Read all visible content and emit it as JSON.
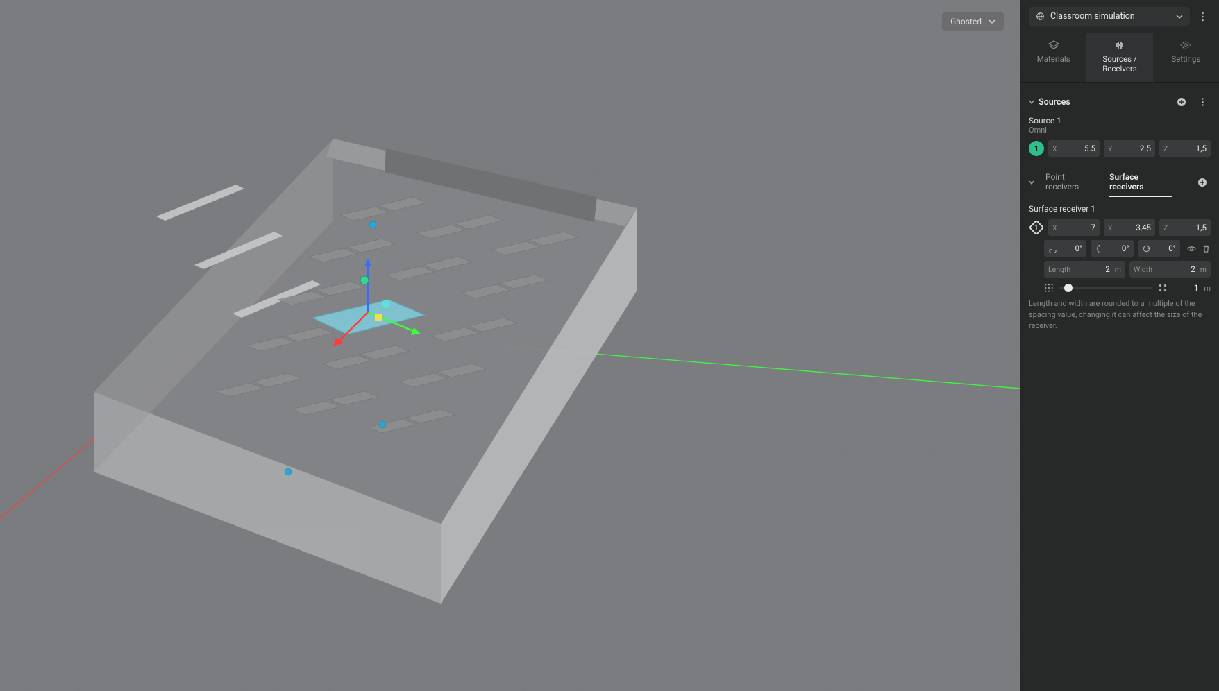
{
  "viewport": {
    "display_mode": "Ghosted"
  },
  "header": {
    "simulation_name": "Classroom simulation"
  },
  "tabs": {
    "materials": "Materials",
    "sources": "Sources / Receivers",
    "settings": "Settings",
    "active": "sources"
  },
  "sources_section": {
    "title": "Sources"
  },
  "source": {
    "name": "Source 1",
    "type": "Omni",
    "badge": "1",
    "x_label": "X",
    "x": "5.5",
    "y_label": "Y",
    "y": "2.5",
    "z_label": "Z",
    "z": "1,5"
  },
  "receiver_tabs": {
    "point": "Point receivers",
    "surface": "Surface receivers"
  },
  "surface_receiver": {
    "name": "Surface receiver 1",
    "badge": "1",
    "x_label": "X",
    "x": "7",
    "y_label": "Y",
    "y": "3,45",
    "z_label": "Z",
    "z": "1,5",
    "rx": "0°",
    "ry": "0°",
    "rz": "0°",
    "length_label": "Length",
    "length_val": "2",
    "length_unit": "m",
    "width_label": "Width",
    "width_val": "2",
    "width_unit": "m",
    "spacing_val": "1",
    "spacing_unit": "m"
  },
  "hint": "Length and width are rounded to a multiple of the spacing value, changing it can affect the size of the receiver."
}
